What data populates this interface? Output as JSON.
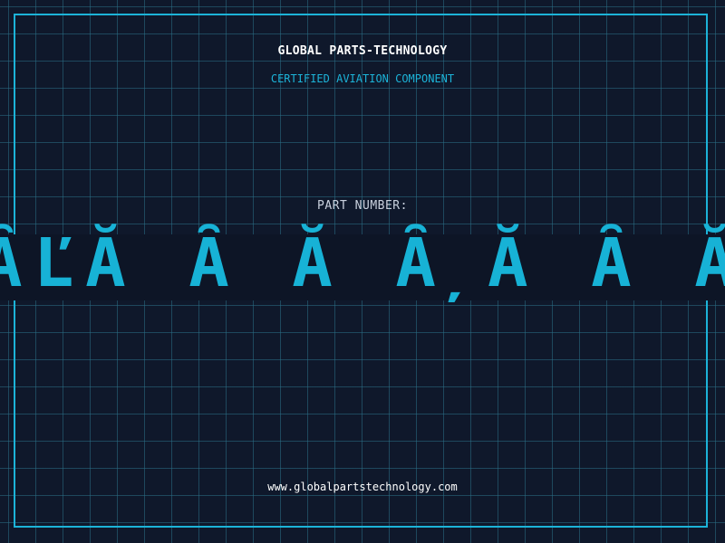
{
  "header": {
    "title": "GLOBAL PARTS-TECHNOLOGY",
    "subtitle": "CERTIFIED AVIATION COMPONENT"
  },
  "part": {
    "label": "PART NUMBER:",
    "number": "ȂĽĂ Ȃ Ă Ȃ̦Ă Ȃ Ă ȂźĂ"
  },
  "footer": {
    "website": "www.globalpartstechnology.com"
  },
  "colors": {
    "background": "#0f182b",
    "accent": "#1cb3d8",
    "text": "#ffffff",
    "label": "#c9d1de"
  }
}
